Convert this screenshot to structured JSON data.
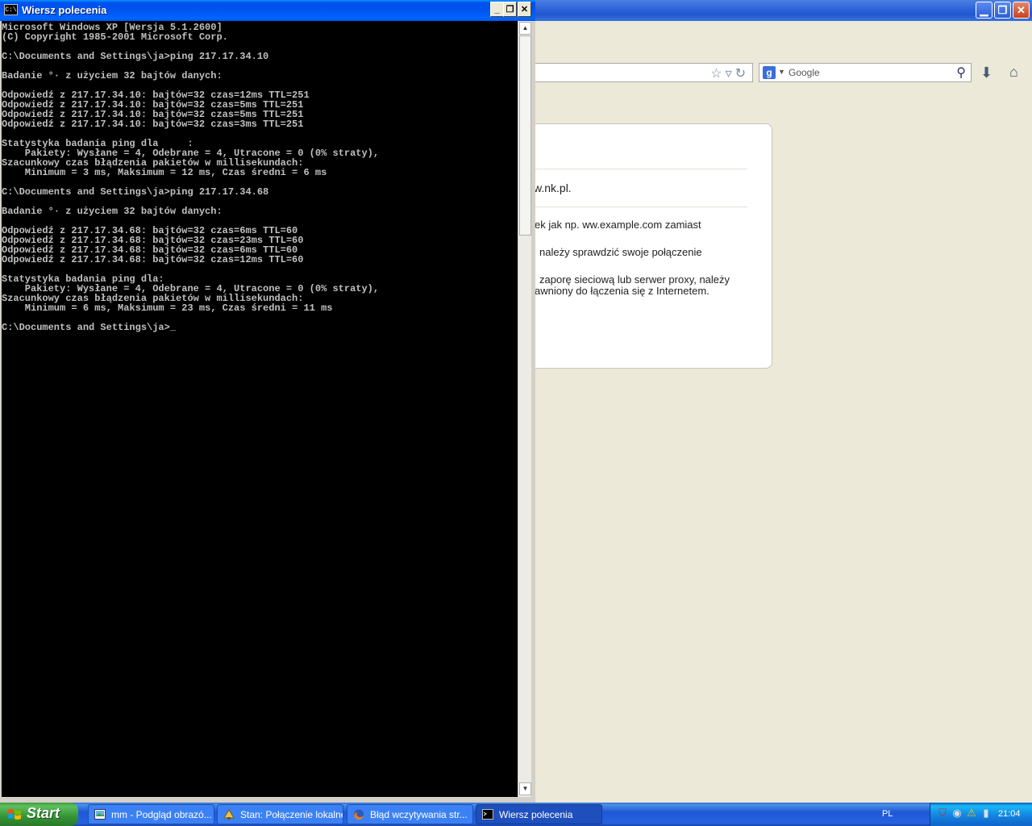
{
  "browser": {
    "search_placeholder": "Google",
    "error_lines": [
      "w.nk.pl.",
      "ek jak np. ww.example.com zamiast",
      "należy sprawdzić swoje połączenie",
      "zaporę sieciową lub serwer proxy, należy",
      "awniony do łączenia się z Internetem."
    ]
  },
  "cmd": {
    "title": "Wiersz polecenia",
    "icon_label": "C:\\",
    "output": "Microsoft Windows XP [Wersja 5.1.2600]\n(C) Copyright 1985-2001 Microsoft Corp.\n\nC:\\Documents and Settings\\ja>ping 217.17.34.10\n\nBadanie °· z użyciem 32 bajtów danych:\n\nOdpowiedź z 217.17.34.10: bajtów=32 czas=12ms TTL=251\nOdpowiedź z 217.17.34.10: bajtów=32 czas=5ms TTL=251\nOdpowiedź z 217.17.34.10: bajtów=32 czas=5ms TTL=251\nOdpowiedź z 217.17.34.10: bajtów=32 czas=3ms TTL=251\n\nStatystyka badania ping dla     :\n    Pakiety: Wysłane = 4, Odebrane = 4, Utracone = 0 (0% straty),\nSzacunkowy czas błądzenia pakietów w millisekundach:\n    Minimum = 3 ms, Maksimum = 12 ms, Czas średni = 6 ms\n\nC:\\Documents and Settings\\ja>ping 217.17.34.68\n\nBadanie °· z użyciem 32 bajtów danych:\n\nOdpowiedź z 217.17.34.68: bajtów=32 czas=6ms TTL=60\nOdpowiedź z 217.17.34.68: bajtów=32 czas=23ms TTL=60\nOdpowiedź z 217.17.34.68: bajtów=32 czas=6ms TTL=60\nOdpowiedź z 217.17.34.68: bajtów=32 czas=12ms TTL=60\n\nStatystyka badania ping dla:\n    Pakiety: Wysłane = 4, Odebrane = 4, Utracone = 0 (0% straty),\nSzacunkowy czas błądzenia pakietów w millisekundach:\n    Minimum = 6 ms, Maksimum = 23 ms, Czas średni = 11 ms\n\nC:\\Documents and Settings\\ja>_"
  },
  "taskbar": {
    "start_label": "Start",
    "buttons": [
      {
        "label": "mm - Podgląd obrazó..."
      },
      {
        "label": "Stan: Połączenie lokalne"
      },
      {
        "label": "Błąd wczytywania str..."
      },
      {
        "label": "Wiersz polecenia"
      }
    ],
    "language": "PL",
    "clock": "21:04"
  },
  "colors": {
    "console_bg": "#000000",
    "console_text": "#c0c0c0",
    "xp_blue": "#0055ea",
    "start_green": "#3c9a3c"
  }
}
